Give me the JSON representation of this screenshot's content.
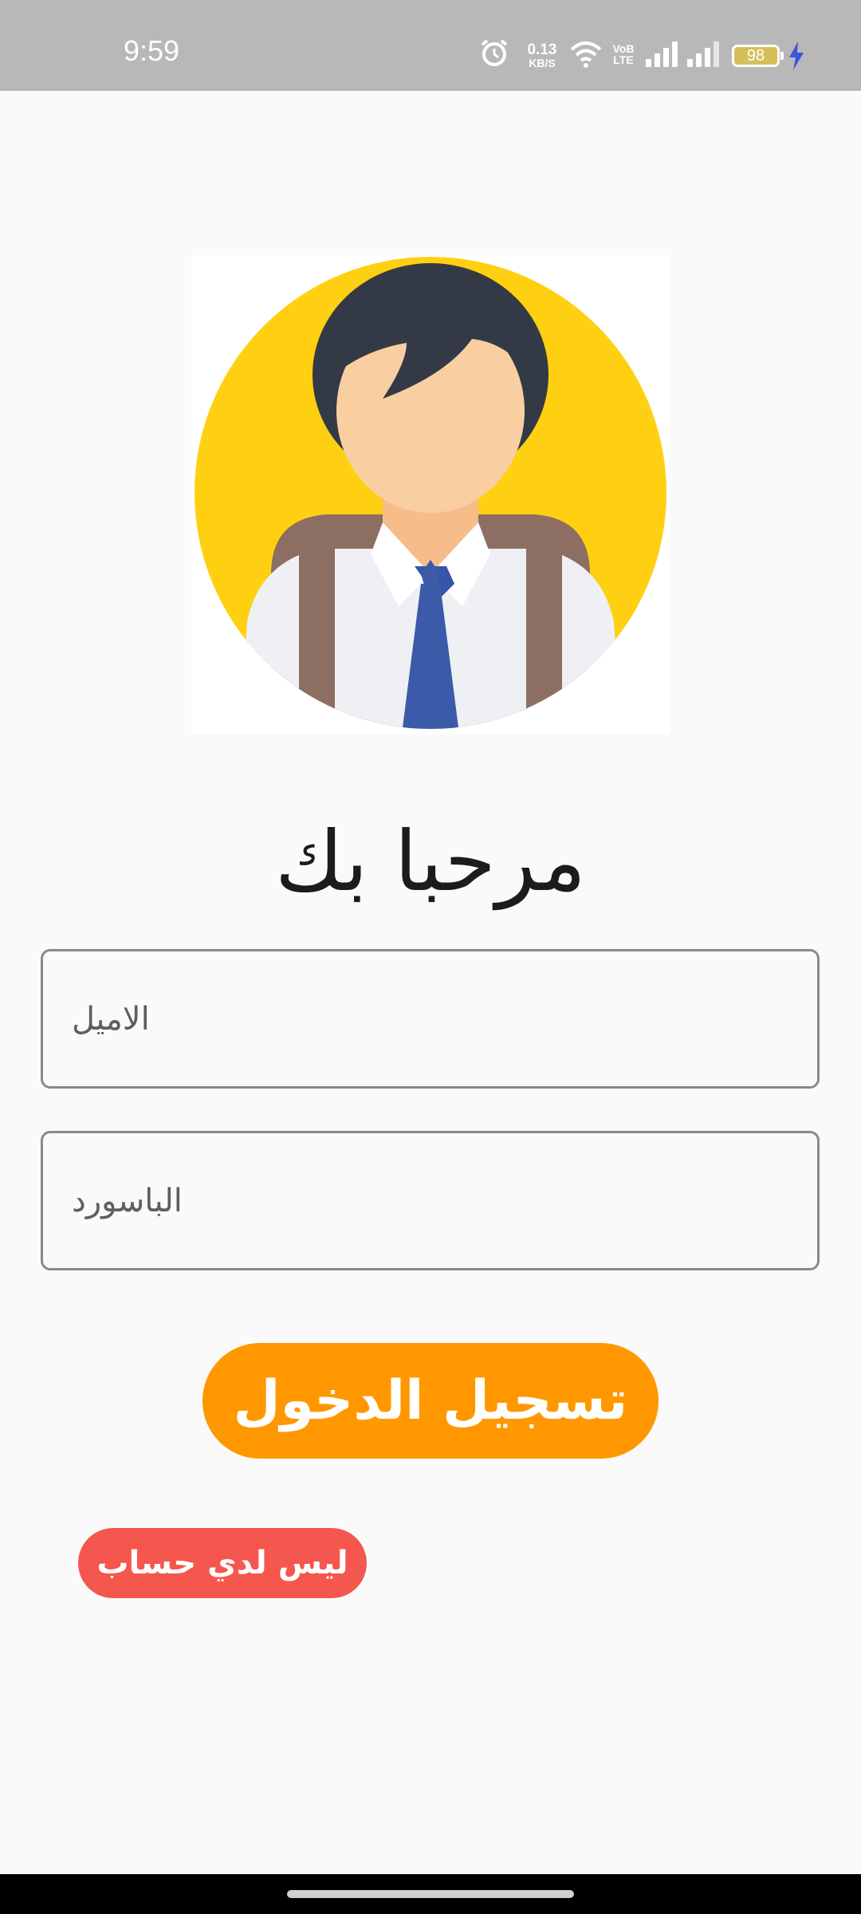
{
  "status_bar": {
    "time": "9:59",
    "net_speed_value": "0.13",
    "net_speed_unit": "KB/S",
    "volte_top": "VoB",
    "volte_bottom": "LTE",
    "battery_level": "98",
    "icons": [
      "alarm-icon",
      "wifi-icon",
      "volte-icon",
      "signal-icon",
      "signal-icon",
      "battery-icon",
      "charging-icon"
    ]
  },
  "avatar": {
    "icon": "student-avatar-icon",
    "background_color": "#ffd012"
  },
  "greeting": "مرحبا بك",
  "form": {
    "email_placeholder": "الاميل",
    "password_placeholder": "الباسورد"
  },
  "buttons": {
    "login_label": "تسجيل الدخول",
    "no_account_label": "ليس لدي حساب"
  },
  "colors": {
    "primary": "#ff9800",
    "secondary": "#f4574e",
    "background": "#fafafa",
    "status_bar": "#b8b8b8"
  }
}
